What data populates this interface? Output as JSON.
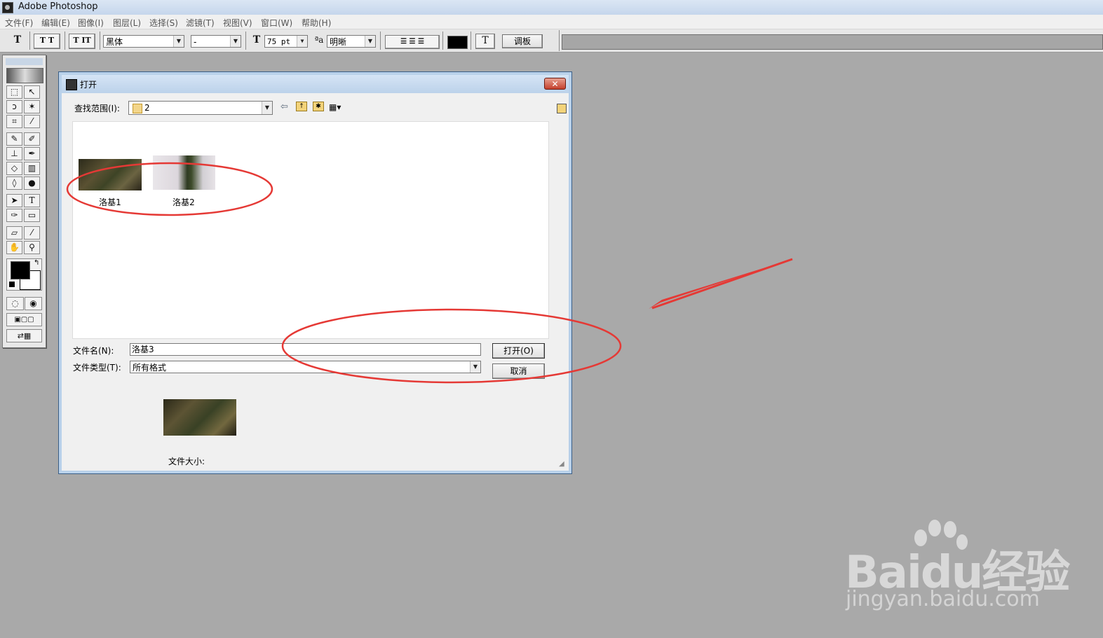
{
  "app": {
    "title": "Adobe Photoshop"
  },
  "menu": [
    "文件(F)",
    "编辑(E)",
    "图像(I)",
    "图层(L)",
    "选择(S)",
    "滤镜(T)",
    "视图(V)",
    "窗口(W)",
    "帮助(H)"
  ],
  "options": {
    "font_family": "黑体",
    "font_style": "-",
    "font_size": "75 pt",
    "antialias": "明晰",
    "palette_button": "调板"
  },
  "dialog": {
    "title": "打开",
    "close_glyph": "✕",
    "look_in_label": "查找范围(I):",
    "look_in_value": "2",
    "files": [
      {
        "name": "洛基1"
      },
      {
        "name": "洛基2"
      }
    ],
    "filename_label": "文件名(N):",
    "filename_value": "洛基3",
    "filetype_label": "文件类型(T):",
    "filetype_value": "所有格式",
    "open_button": "打开(O)",
    "cancel_button": "取消",
    "file_size_label": "文件大小:"
  },
  "watermark": {
    "brand": "Baidu经验",
    "url": "jingyan.baidu.com"
  },
  "colors": {
    "annotation": "#e53935",
    "background": "#a9a9a9"
  }
}
